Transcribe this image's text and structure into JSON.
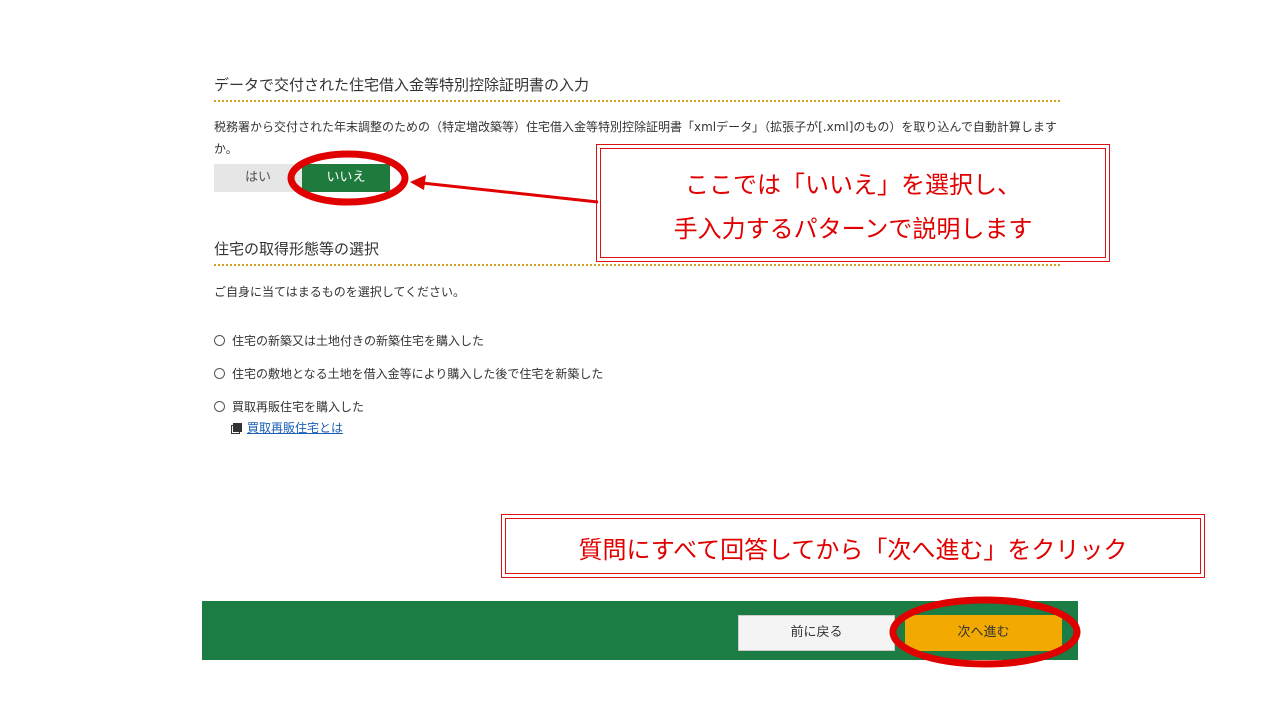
{
  "section1": {
    "title": "データで交付された住宅借入金等特別控除証明書の入力",
    "description": "税務署から交付された年末調整のための（特定増改築等）住宅借入金等特別控除証明書「xmlデータ」（拡張子が[.xml]のもの）を取り込んで自動計算しますか。",
    "yes_label": "はい",
    "no_label": "いいえ",
    "selected": "いいえ"
  },
  "section2": {
    "title": "住宅の取得形態等の選択",
    "instruction": "ご自身に当てはまるものを選択してください。",
    "options": [
      {
        "label": "住宅の新築又は土地付きの新築住宅を購入した"
      },
      {
        "label": "住宅の敷地となる土地を借入金等により購入した後で住宅を新築した"
      },
      {
        "label": "買取再販住宅を購入した"
      }
    ],
    "help_link": "買取再販住宅とは"
  },
  "callouts": {
    "top_line1": "ここでは「いいえ」を選択し、",
    "top_line2": "手入力するパターンで説明します",
    "bottom": "質問にすべて回答してから「次へ進む」をクリック"
  },
  "footer": {
    "back_label": "前に戻る",
    "next_label": "次へ進む"
  },
  "colors": {
    "accent_green": "#1b7c44",
    "next_button": "#f2a900",
    "annotation_red": "#e00000",
    "divider_gold": "#d4a017"
  }
}
